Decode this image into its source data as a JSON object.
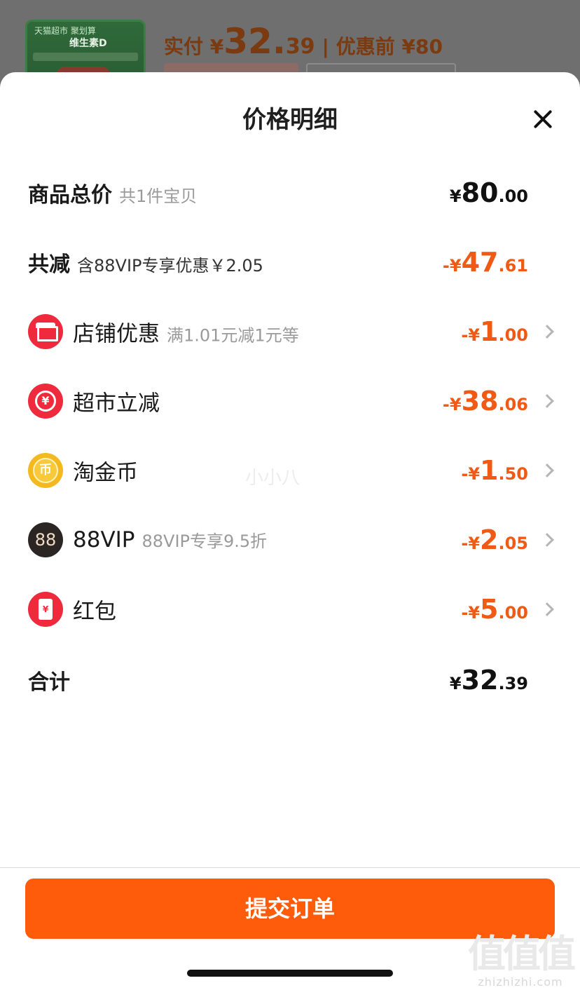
{
  "background": {
    "thumb_line1": "天猫超市 聚划算",
    "thumb_line2": "维生素D",
    "price_label": "实付 ¥",
    "price_int": "32.",
    "price_dec": "39",
    "separator": "|",
    "original_label": "优惠前 ¥80"
  },
  "sheet": {
    "title": "价格明细",
    "close_icon": "close-icon"
  },
  "rows": {
    "total": {
      "label": "商品总价",
      "sub": "共1件宝贝",
      "sym": "¥",
      "int": "80",
      "dec": ".00"
    },
    "discount": {
      "label": "共减",
      "sub": "含88VIP专享优惠￥2.05",
      "sym": "-¥",
      "int": "47",
      "dec": ".61"
    },
    "shop": {
      "label": "店铺优惠",
      "sub": "满1.01元减1元等",
      "sym": "-¥",
      "int": "1",
      "dec": ".00",
      "icon": "store-icon"
    },
    "market": {
      "label": "超市立减",
      "sym": "-¥",
      "int": "38",
      "dec": ".06",
      "icon": "yen-coin-icon",
      "glyph": "¥"
    },
    "coin": {
      "label": "淘金币",
      "sym": "-¥",
      "int": "1",
      "dec": ".50",
      "icon": "gold-coin-icon",
      "glyph": "币"
    },
    "vip": {
      "label": "88VIP",
      "sub": "88VIP专享9.5折",
      "sym": "-¥",
      "int": "2",
      "dec": ".05",
      "icon": "vip-icon",
      "glyph": "88"
    },
    "redpacket": {
      "label": "红包",
      "sym": "-¥",
      "int": "5",
      "dec": ".00",
      "icon": "red-packet-icon",
      "glyph": "¥"
    },
    "sum": {
      "label": "合计",
      "sym": "¥",
      "int": "32",
      "dec": ".39"
    }
  },
  "watermark_center": "小小八",
  "footer": {
    "submit_label": "提交订单",
    "logo_glyphs": "值值值",
    "logo_url": "zhizhizhi.com"
  },
  "colors": {
    "accent_orange": "#fe5b0b",
    "discount_text": "#f05a14",
    "icon_red": "#ee2a3c"
  }
}
